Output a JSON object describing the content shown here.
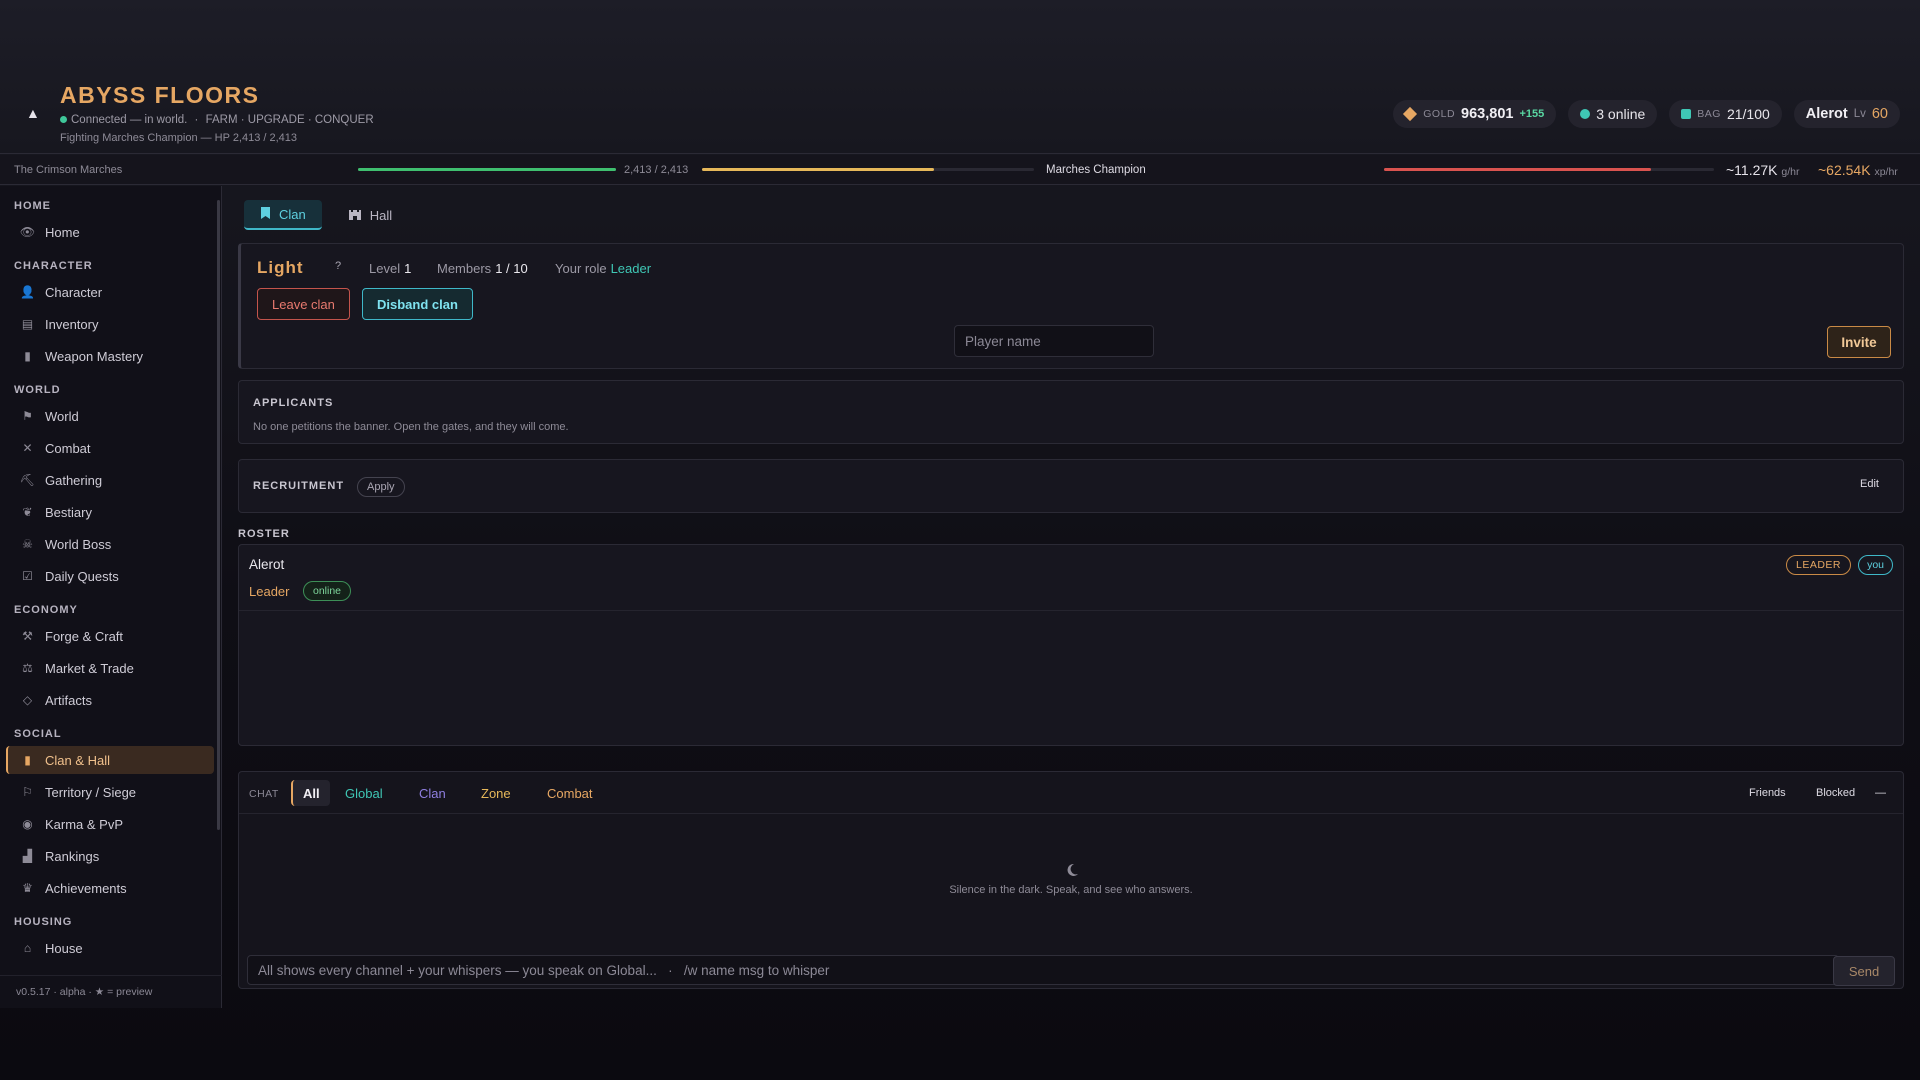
{
  "header": {
    "title": "ABYSS FLOORS",
    "status": "Connected — in world.",
    "tagline": "FARM · UPGRADE · CONQUER",
    "fight_status": "Fighting Marches Champion — HP 2,413 / 2,413",
    "gold_label": "GOLD",
    "gold_value": "963,801",
    "gold_gain": "+155",
    "online": "3 online",
    "bag_label": "BAG",
    "bag_value": "21/100",
    "player_name": "Alerot",
    "level_label": "Lv",
    "level": "60"
  },
  "progress": {
    "zone": "The Crimson Marches",
    "player_hp_text": "2,413 / 2,413",
    "player_hp_fraction": 1.0,
    "stamina_fraction": 0.7,
    "enemy_name": "Marches Champion",
    "enemy_hp_fraction": 0.81,
    "gold_rate": "~11.27K",
    "gold_rate_unit": "g/hr",
    "xp_rate": "~62.54K",
    "xp_rate_unit": "xp/hr",
    "colors": {
      "hp": "#3fbf6f",
      "stamina": "#e6b85a",
      "enemy": "#d9534f"
    }
  },
  "sidebar": {
    "sections": [
      {
        "title": "HOME",
        "items": [
          {
            "label": "Home",
            "icon": "eye-icon",
            "glyph": "👁"
          }
        ]
      },
      {
        "title": "CHARACTER",
        "items": [
          {
            "label": "Character",
            "icon": "person-icon",
            "glyph": "👤"
          },
          {
            "label": "Inventory",
            "icon": "chest-icon",
            "glyph": "▤"
          },
          {
            "label": "Weapon Mastery",
            "icon": "book-icon",
            "glyph": "▮"
          }
        ]
      },
      {
        "title": "WORLD",
        "items": [
          {
            "label": "World",
            "icon": "signpost-icon",
            "glyph": "⚑"
          },
          {
            "label": "Combat",
            "icon": "crossed-swords-icon",
            "glyph": "✕"
          },
          {
            "label": "Gathering",
            "icon": "pickaxe-icon",
            "glyph": "⛏"
          },
          {
            "label": "Bestiary",
            "icon": "paw-icon",
            "glyph": "❦"
          },
          {
            "label": "World Boss",
            "icon": "skull-icon",
            "glyph": "☠"
          },
          {
            "label": "Daily Quests",
            "icon": "checkbox-icon",
            "glyph": "☑"
          }
        ]
      },
      {
        "title": "ECONOMY",
        "items": [
          {
            "label": "Forge & Craft",
            "icon": "anvil-icon",
            "glyph": "⚒"
          },
          {
            "label": "Market & Trade",
            "icon": "scales-icon",
            "glyph": "⚖"
          },
          {
            "label": "Artifacts",
            "icon": "gem-icon",
            "glyph": "◇"
          }
        ]
      },
      {
        "title": "SOCIAL",
        "items": [
          {
            "label": "Clan & Hall",
            "icon": "bookmark-icon",
            "glyph": "▮",
            "active": true
          },
          {
            "label": "Territory / Siege",
            "icon": "flag-icon",
            "glyph": "⚐"
          },
          {
            "label": "Karma & PvP",
            "icon": "drop-icon",
            "glyph": "◉"
          },
          {
            "label": "Rankings",
            "icon": "podium-icon",
            "glyph": "▟"
          },
          {
            "label": "Achievements",
            "icon": "trophy-icon",
            "glyph": "♛"
          }
        ]
      },
      {
        "title": "HOUSING",
        "items": [
          {
            "label": "House",
            "icon": "house-icon",
            "glyph": "⌂"
          }
        ]
      }
    ],
    "version": "v0.5.17 · alpha · ★ = preview"
  },
  "tabs": [
    {
      "label": "Clan",
      "icon": "bookmark-icon",
      "glyph": "🔖",
      "active": true
    },
    {
      "label": "Hall",
      "icon": "castle-icon",
      "glyph": "🏰",
      "active": false
    }
  ],
  "clan": {
    "name": "Light",
    "help": "?",
    "level_label": "Level",
    "level": "1",
    "members_label": "Members",
    "members": "1 / 10",
    "role_label": "Your role",
    "role": "Leader",
    "leave_label": "Leave clan",
    "disband_label": "Disband clan",
    "player_placeholder": "Player name",
    "invite_label": "Invite"
  },
  "applicants": {
    "title": "APPLICANTS",
    "empty_text": "No one petitions the banner. Open the gates, and they will come."
  },
  "recruitment": {
    "title": "RECRUITMENT",
    "mode": "Apply",
    "edit_label": "Edit"
  },
  "roster": {
    "title": "ROSTER",
    "members": [
      {
        "name": "Alerot",
        "role": "Leader",
        "status": "online",
        "rank_badge": "LEADER",
        "self_badge": "you"
      }
    ]
  },
  "chat": {
    "label": "CHAT",
    "tabs": [
      {
        "label": "All",
        "color": "#f1eff4",
        "active": true
      },
      {
        "label": "Global",
        "color": "#3fc7b5"
      },
      {
        "label": "Clan",
        "color": "#8f7fe0"
      },
      {
        "label": "Zone",
        "color": "#e6b85a"
      },
      {
        "label": "Combat",
        "color": "#e6a763"
      }
    ],
    "friends_label": "Friends",
    "blocked_label": "Blocked",
    "minimize_label": "—",
    "empty_text": "Silence in the dark. Speak, and see who answers.",
    "input_placeholder": "All shows every channel + your whispers — you speak on Global...   ·   /w name msg to whisper",
    "send_label": "Send"
  }
}
